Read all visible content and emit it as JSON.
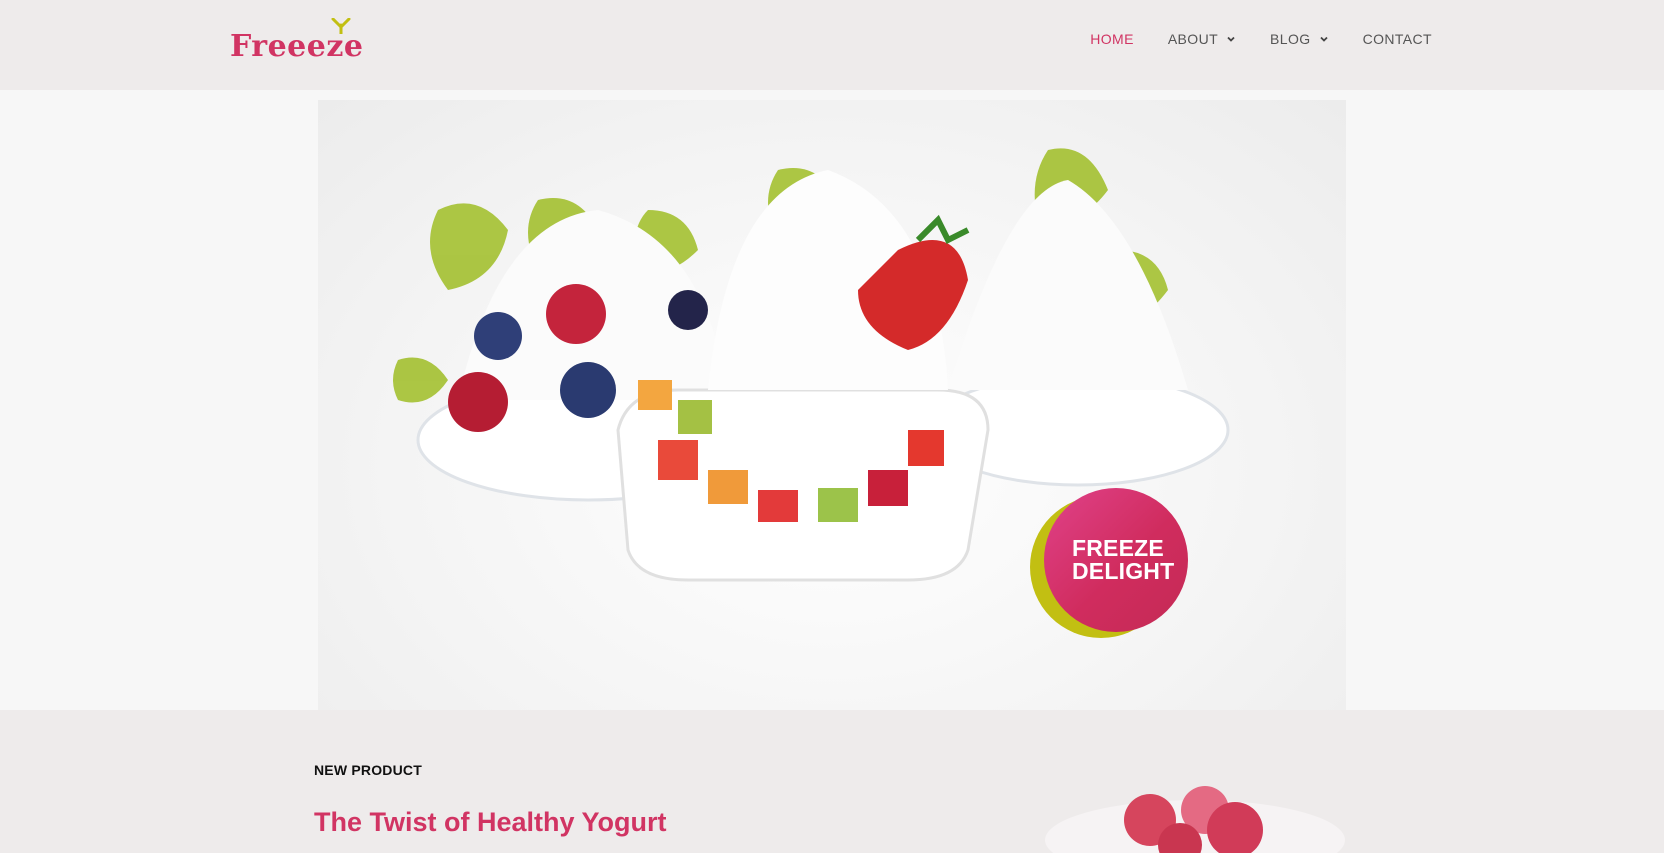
{
  "header": {
    "logo_text": "Freeeze",
    "nav": [
      {
        "label": "HOME",
        "active": true,
        "has_dropdown": false
      },
      {
        "label": "ABOUT",
        "active": false,
        "has_dropdown": true
      },
      {
        "label": "BLOG",
        "active": false,
        "has_dropdown": true
      },
      {
        "label": "CONTACT",
        "active": false,
        "has_dropdown": false
      }
    ]
  },
  "hero": {
    "image": "frozen-yogurt-cups-with-fruit",
    "badge": {
      "line1": "FREEZE",
      "line2": "DELIGHT"
    }
  },
  "section": {
    "eyebrow": "NEW PRODUCT",
    "headline": "The Twist of Healthy Yogurt",
    "image": "raspberries"
  },
  "colors": {
    "brand": "#d13463",
    "accent": "#c2bf12",
    "background": "#eeebeb"
  }
}
